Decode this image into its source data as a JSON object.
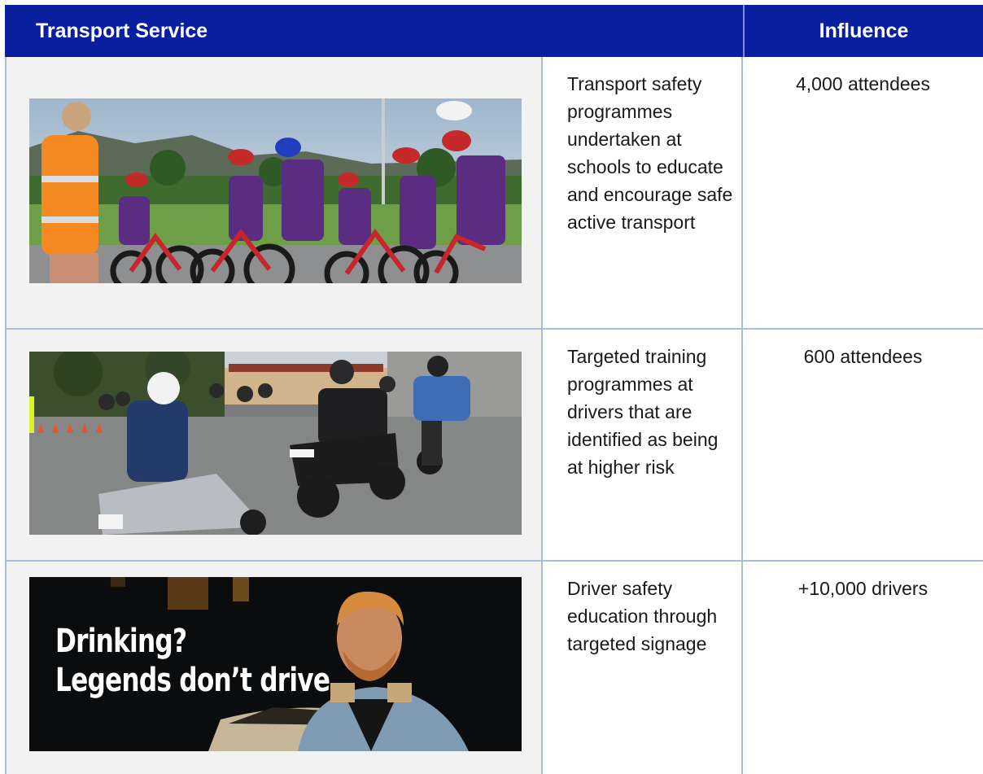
{
  "table": {
    "headers": {
      "service": "Transport Service",
      "influence": "Influence"
    },
    "rows": [
      {
        "image": "children-cycling-safety-photo",
        "description": "Transport safety programmes undertaken at schools to educate and encourage safe active transport",
        "influence": "4,000 attendees"
      },
      {
        "image": "motorcycle-training-photo",
        "description": "Targeted training programmes at drivers that are identified as being at higher risk",
        "influence": "600 attendees"
      },
      {
        "image": "drink-driving-signage-photo",
        "image_text_line1": "Drinking?",
        "image_text_line2": "Legends don’t drive",
        "description": "Driver safety education through targeted signage",
        "influence": "+10,000 drivers"
      }
    ]
  },
  "colors": {
    "header_bg": "#0a1fa0",
    "grid": "#a9bdd8",
    "image_cell_bg": "#f2f2f2"
  }
}
